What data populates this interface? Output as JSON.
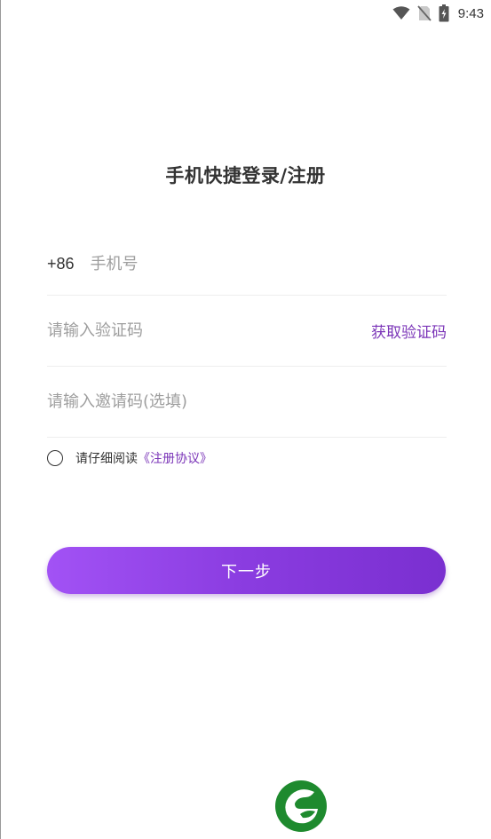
{
  "status_bar": {
    "time": "9:43",
    "icons": [
      "wifi-icon",
      "no-sim-icon",
      "battery-charging-icon"
    ]
  },
  "header": {
    "title": "手机快捷登录/注册"
  },
  "form": {
    "phone": {
      "country_code": "+86",
      "placeholder": "手机号",
      "value": ""
    },
    "verify_code": {
      "placeholder": "请输入验证码",
      "value": "",
      "get_code_label": "获取验证码"
    },
    "invite_code": {
      "placeholder": "请输入邀请码(选填)",
      "value": ""
    }
  },
  "agreement": {
    "checked": false,
    "text": "请仔细阅读",
    "link_text": "《注册协议》"
  },
  "actions": {
    "next_label": "下一步"
  },
  "branding": {
    "logo_icon": "app-logo-leaf-icon",
    "logo_color": "#1e8a2e"
  },
  "colors": {
    "accent": "#7b35b8",
    "button_gradient_start": "#a252f5",
    "button_gradient_end": "#7a2fd0"
  }
}
